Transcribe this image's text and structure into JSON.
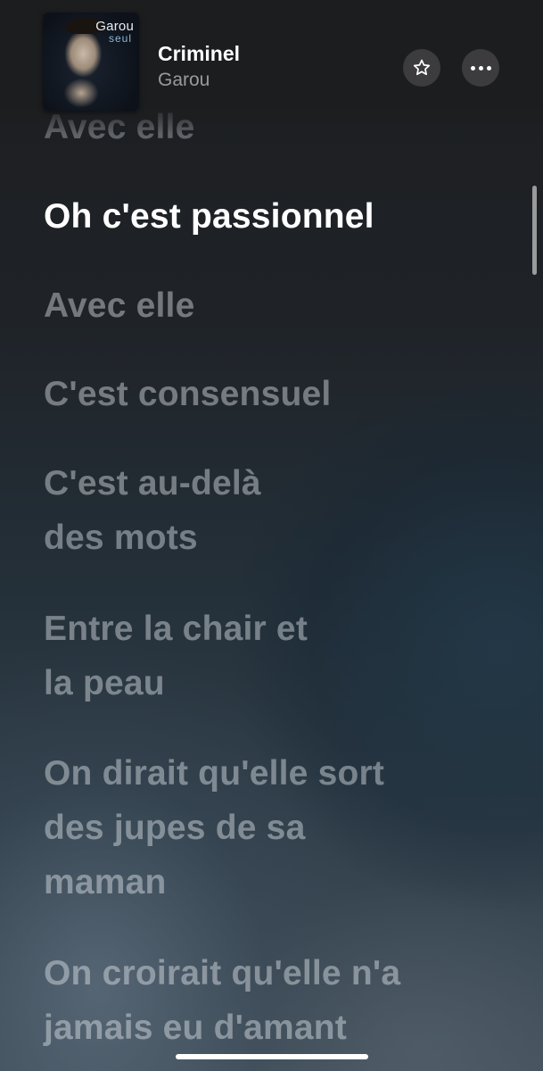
{
  "now_playing": {
    "title": "Criminel",
    "artist": "Garou",
    "album_art": {
      "artist_text": "Garou",
      "album_text": "seul"
    },
    "favorite_icon": "star-outline-icon",
    "more_icon": "ellipsis-icon"
  },
  "lyrics": {
    "previous_line": "Avec elle",
    "current_line": "Oh c'est passionnel",
    "upcoming": [
      "Avec elle",
      "C'est consensuel",
      "C'est au-delà\ndes mots",
      "Entre la chair et\nla peau",
      "On dirait qu'elle sort\ndes jupes de sa\nmaman",
      "On croirait qu'elle n'a\njamais eu d'amant"
    ]
  },
  "colors": {
    "current_lyric": "#ffffff",
    "inactive_lyric": "rgba(235,240,245,0.42)"
  }
}
